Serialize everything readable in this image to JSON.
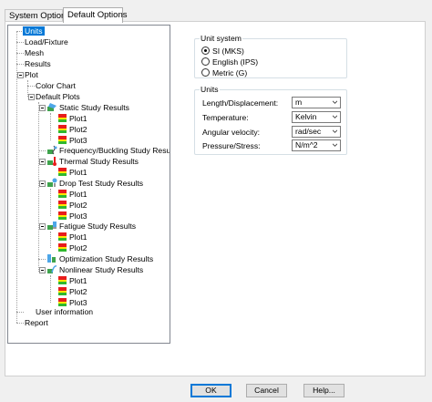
{
  "tabs": [
    {
      "label": "System Options",
      "active": false
    },
    {
      "label": "Default Options",
      "active": true
    }
  ],
  "tree": [
    {
      "label": "Units",
      "selected": true
    },
    {
      "label": "Load/Fixture"
    },
    {
      "label": "Mesh"
    },
    {
      "label": "Results"
    },
    {
      "label": "Plot"
    },
    {
      "label": "Color Chart"
    },
    {
      "label": "Default Plots"
    },
    {
      "label": "Static Study Results",
      "icon": "static-study-icon"
    },
    {
      "label": "Plot1",
      "icon": "plot-icon"
    },
    {
      "label": "Plot2",
      "icon": "plot-icon"
    },
    {
      "label": "Plot3",
      "icon": "plot-icon"
    },
    {
      "label": "Frequency/Buckling Study Results",
      "icon": "frequency-study-icon"
    },
    {
      "label": "Thermal Study Results",
      "icon": "thermal-study-icon"
    },
    {
      "label": "Plot1",
      "icon": "plot-icon"
    },
    {
      "label": "Drop Test Study Results",
      "icon": "drop-test-study-icon"
    },
    {
      "label": "Plot1",
      "icon": "plot-icon"
    },
    {
      "label": "Plot2",
      "icon": "plot-icon"
    },
    {
      "label": "Plot3",
      "icon": "plot-icon"
    },
    {
      "label": "Fatigue Study Results",
      "icon": "fatigue-study-icon"
    },
    {
      "label": "Plot1",
      "icon": "plot-icon"
    },
    {
      "label": "Plot2",
      "icon": "plot-icon"
    },
    {
      "label": "Optimization Study Results",
      "icon": "optimization-study-icon"
    },
    {
      "label": "Nonlinear Study Results",
      "icon": "nonlinear-study-icon"
    },
    {
      "label": "Plot1",
      "icon": "plot-icon"
    },
    {
      "label": "Plot2",
      "icon": "plot-icon"
    },
    {
      "label": "Plot3",
      "icon": "plot-icon"
    },
    {
      "label": "User information"
    },
    {
      "label": "Report"
    }
  ],
  "unit_system": {
    "title": "Unit system",
    "options": [
      {
        "label": "SI (MKS)",
        "checked": true
      },
      {
        "label": "English (IPS)",
        "checked": false
      },
      {
        "label": "Metric (G)",
        "checked": false
      }
    ]
  },
  "units": {
    "title": "Units",
    "rows": [
      {
        "label": "Length/Displacement:",
        "value": "m"
      },
      {
        "label": "Temperature:",
        "value": "Kelvin"
      },
      {
        "label": "Angular velocity:",
        "value": "rad/sec"
      },
      {
        "label": "Pressure/Stress:",
        "value": "N/m^2"
      }
    ]
  },
  "buttons": {
    "ok": "OK",
    "cancel": "Cancel",
    "help": "Help..."
  },
  "colors": {
    "accent": "#0078d7",
    "plot_icon_red": "#e81c1c",
    "plot_icon_yellow": "#ffe600",
    "plot_icon_green": "#2fb82f"
  }
}
